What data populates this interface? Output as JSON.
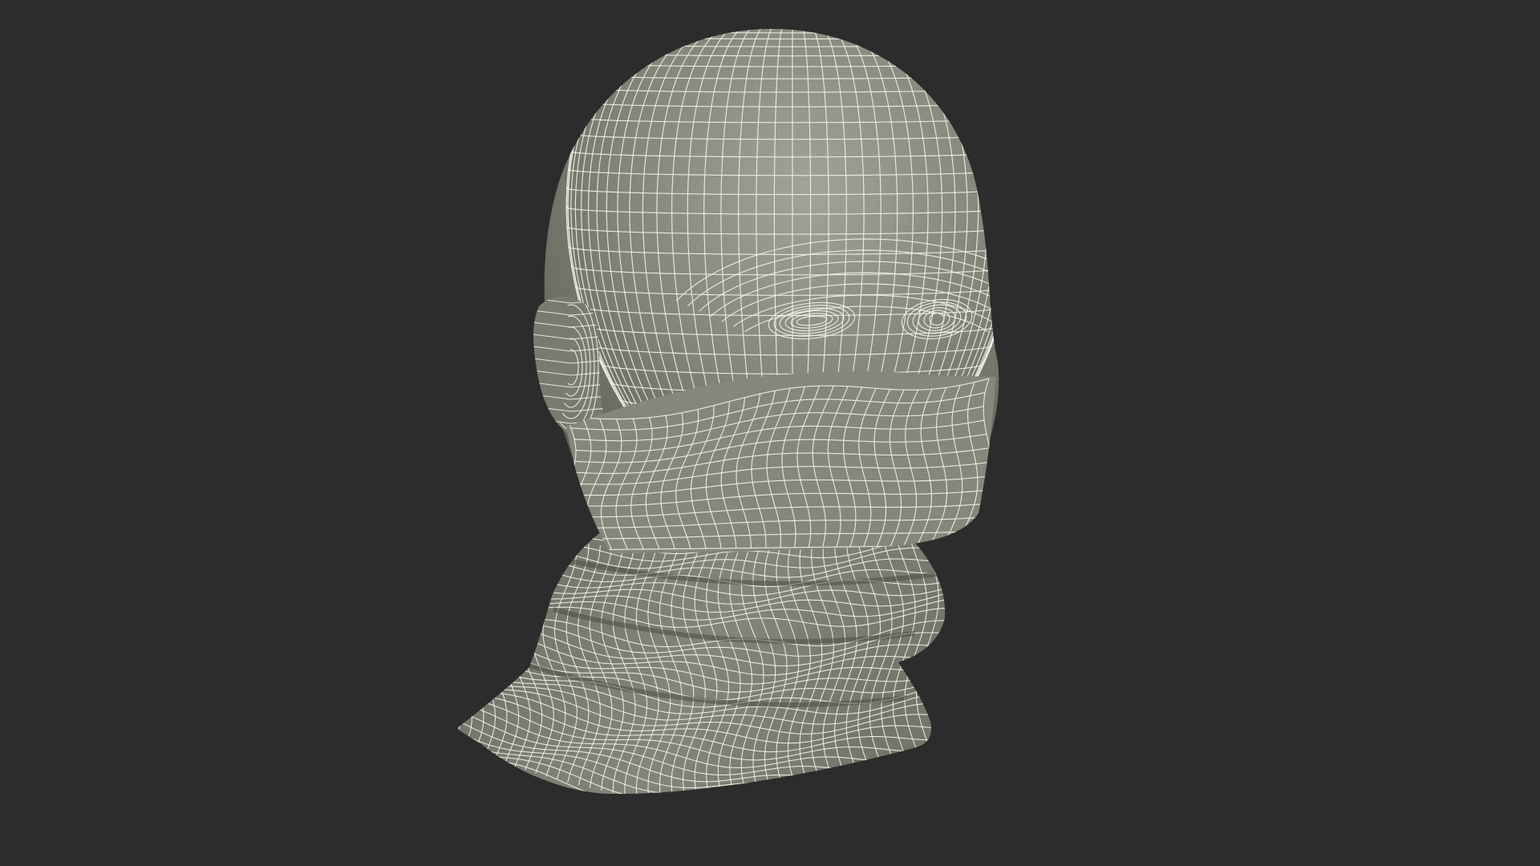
{
  "scene": {
    "subject": "wireframe-head-with-neck-gaiter",
    "background_color": "#2c2c2c",
    "surface_color": "#84847a",
    "surface_shadow_color": "#5d5d55",
    "surface_highlight_color": "#a2a298",
    "wire_color": "#f2f2e6"
  }
}
